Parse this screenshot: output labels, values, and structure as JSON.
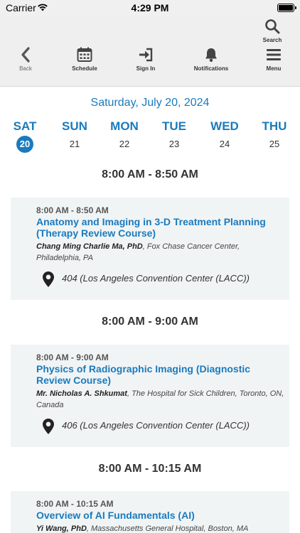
{
  "status_bar": {
    "carrier": "Carrier",
    "time": "4:29 PM"
  },
  "toolbar": {
    "search_label": "Search",
    "back_label": "Back",
    "schedule_label": "Schedule",
    "signin_label": "Sign In",
    "notifications_label": "Notifications",
    "menu_label": "Menu"
  },
  "date_header": "Saturday, July 20, 2024",
  "days": [
    {
      "name": "SAT",
      "num": "20",
      "active": true
    },
    {
      "name": "SUN",
      "num": "21"
    },
    {
      "name": "MON",
      "num": "22"
    },
    {
      "name": "TUE",
      "num": "23"
    },
    {
      "name": "WED",
      "num": "24"
    },
    {
      "name": "THU",
      "num": "25"
    }
  ],
  "time_slots": [
    "8:00 AM - 8:50 AM",
    "8:00 AM - 9:00 AM",
    "8:00 AM - 10:15 AM"
  ],
  "sessions": [
    {
      "time": "8:00 AM - 8:50 AM",
      "title": "Anatomy and Imaging in 3-D Treatment Planning (Therapy Review Course)",
      "speaker_name": "Chang Ming Charlie Ma, PhD",
      "speaker_affil": ", Fox Chase Cancer Center, Philadelphia, PA",
      "location": "404 (Los Angeles Convention Center (LACC))"
    },
    {
      "time": "8:00 AM - 9:00 AM",
      "title": "Physics of Radiographic Imaging (Diagnostic Review Course)",
      "speaker_name": "Mr. Nicholas A. Shkumat",
      "speaker_affil": ", The Hospital for Sick Children, Toronto, ON, Canada",
      "location": "406 (Los Angeles Convention Center (LACC))"
    },
    {
      "time": "8:00 AM - 10:15 AM",
      "title": "Overview of AI Fundamentals (AI)",
      "speaker_name": "Yi Wang, PhD",
      "speaker_affil": ", Massachusetts General Hospital, Boston, MA"
    }
  ],
  "colors": {
    "accent": "#1a7bbd",
    "card_bg": "#f1f4f5",
    "toolbar_bg": "#efefef"
  }
}
